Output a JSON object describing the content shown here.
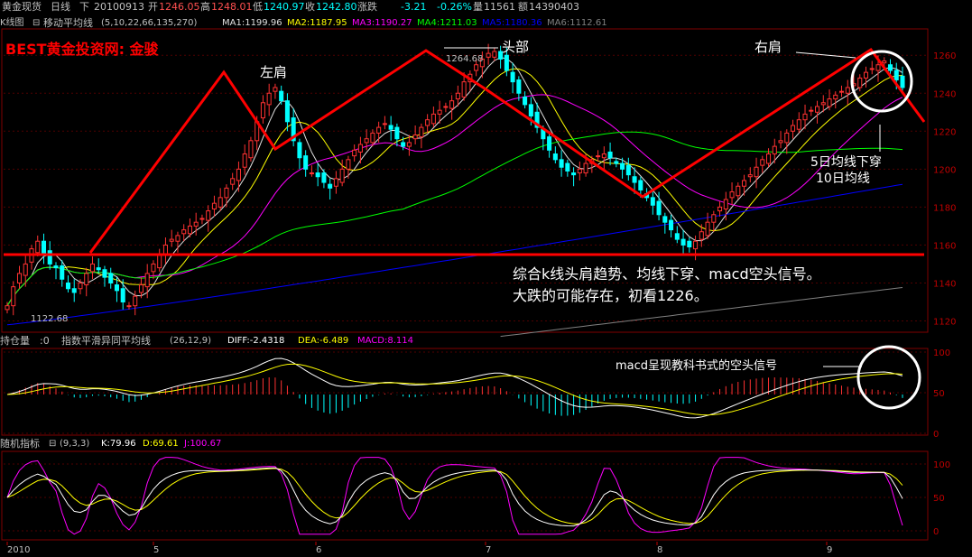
{
  "header": {
    "symbol": "黄金现货",
    "period": "日线",
    "direction_label": "下",
    "date": "20100913",
    "open_label": "开",
    "open": "1246.05",
    "high_label": "高",
    "high": "1248.01",
    "low_label": "低",
    "low": "1240.97",
    "close_label": "收",
    "close": "1242.80",
    "change_label": "涨跌",
    "change": "-3.21",
    "change_pct": "-0.26%",
    "volume_label": "量",
    "volume": "11561",
    "amount_label": "额",
    "amount": "14390403"
  },
  "main_panel": {
    "kline_label": "K线图",
    "ma_name": "移动平均线",
    "ma_params": "(5,10,22,66,135,270)",
    "ma_values": [
      {
        "label": "MA1:1199.96",
        "color": "#e0e0e0"
      },
      {
        "label": "MA2:1187.95",
        "color": "#ffff00"
      },
      {
        "label": "MA3:1190.27",
        "color": "#ff00ff"
      },
      {
        "label": "MA4:1211.03",
        "color": "#00ff00"
      },
      {
        "label": "MA5:1180.36",
        "color": "#0000ff"
      },
      {
        "label": "MA6:1112.61",
        "color": "#808080"
      }
    ],
    "watermark": "BEST黄金投资网: 金骏",
    "annotations": {
      "left_shoulder": "左肩",
      "head": "头部",
      "right_shoulder": "右肩",
      "head_price": "1264.68",
      "low_price": "1122.68",
      "ma_cross": [
        "5日均线下穿",
        "10日均线"
      ],
      "summary": [
        "综合k线头肩趋势、均线下穿、macd空头信号。",
        "大跌的可能存在，初看1226。"
      ]
    }
  },
  "macd_panel": {
    "name": "持仓量",
    "extra": ":0",
    "title": "指数平滑异同平均线",
    "params": "(26,12,9)",
    "diff": "DIFF:-2.4318",
    "dea": "DEA:-6.489",
    "macd": "MACD:8.114",
    "annotation": "macd呈现教科书式的空头信号"
  },
  "kdj_panel": {
    "title": "随机指标",
    "params": "(9,3,3)",
    "k": "K:79.96",
    "d": "D:69.61",
    "j": "J:100.67"
  },
  "x_axis": [
    "2010",
    "5",
    "6",
    "7",
    "8",
    "9"
  ],
  "chart_data": [
    {
      "type": "candlestick",
      "title": "黄金现货 日线",
      "ylim": [
        1115,
        1272
      ],
      "y_ticks": [
        1120,
        1140,
        1160,
        1180,
        1200,
        1220,
        1240,
        1260
      ],
      "x_tick_labels": [
        "2010",
        "5",
        "6",
        "7",
        "8",
        "9"
      ],
      "closes": [
        1128,
        1138,
        1145,
        1150,
        1158,
        1162,
        1155,
        1150,
        1148,
        1142,
        1137,
        1135,
        1140,
        1145,
        1150,
        1147,
        1143,
        1140,
        1136,
        1130,
        1128,
        1133,
        1139,
        1145,
        1150,
        1155,
        1160,
        1163,
        1165,
        1168,
        1170,
        1172,
        1174,
        1178,
        1182,
        1185,
        1190,
        1195,
        1200,
        1208,
        1215,
        1225,
        1235,
        1240,
        1243,
        1236,
        1225,
        1215,
        1206,
        1200,
        1198,
        1196,
        1193,
        1190,
        1195,
        1200,
        1205,
        1210,
        1213,
        1216,
        1219,
        1222,
        1224,
        1221,
        1216,
        1212,
        1214,
        1218,
        1222,
        1226,
        1229,
        1231,
        1233,
        1236,
        1240,
        1246,
        1250,
        1255,
        1258,
        1261,
        1262,
        1258,
        1252,
        1246,
        1240,
        1234,
        1228,
        1222,
        1216,
        1210,
        1205,
        1201,
        1199,
        1197,
        1200,
        1203,
        1205,
        1207,
        1208,
        1206,
        1203,
        1200,
        1197,
        1193,
        1189,
        1185,
        1181,
        1176,
        1172,
        1168,
        1163,
        1160,
        1159,
        1162,
        1167,
        1172,
        1176,
        1180,
        1184,
        1188,
        1191,
        1194,
        1197,
        1201,
        1205,
        1208,
        1212,
        1215,
        1219,
        1223,
        1226,
        1229,
        1231,
        1233,
        1235,
        1237,
        1239,
        1241,
        1243,
        1245,
        1248,
        1251,
        1253,
        1255,
        1257,
        1252,
        1247,
        1243
      ],
      "series": [
        {
          "name": "MA1",
          "color": "#e0e0e0"
        },
        {
          "name": "MA2",
          "color": "#ffff00"
        },
        {
          "name": "MA3",
          "color": "#ff00ff"
        },
        {
          "name": "MA4",
          "color": "#00ff00"
        },
        {
          "name": "MA5",
          "color": "#0000ff"
        },
        {
          "name": "MA6",
          "color": "#808080"
        }
      ]
    },
    {
      "type": "bar",
      "title": "指数平滑异同平均线",
      "y_ticks": [
        0,
        50,
        100
      ],
      "series": [
        {
          "name": "DIFF",
          "color": "#ffffff"
        },
        {
          "name": "DEA",
          "color": "#ffff00"
        },
        {
          "name": "MACD",
          "color": "#ff00ff"
        }
      ]
    },
    {
      "type": "line",
      "title": "随机指标",
      "ylim": [
        0,
        100
      ],
      "y_ticks": [
        0,
        50,
        100
      ],
      "series": [
        {
          "name": "K",
          "color": "#ffffff"
        },
        {
          "name": "D",
          "color": "#ffff00"
        },
        {
          "name": "J",
          "color": "#ff00ff"
        }
      ]
    }
  ]
}
